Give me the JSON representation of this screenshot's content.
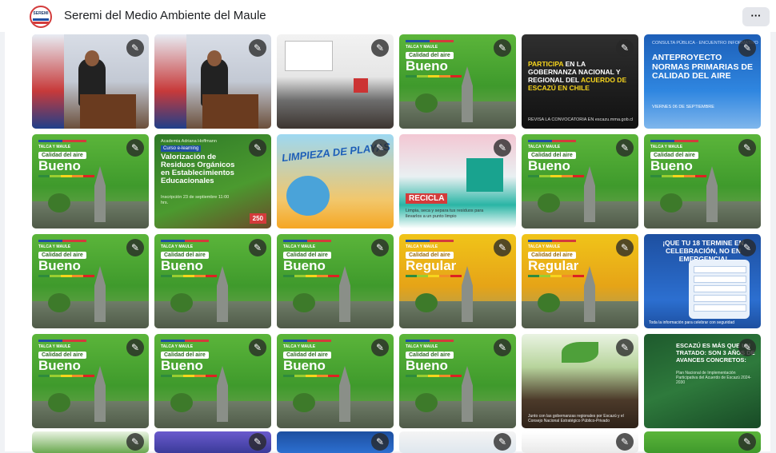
{
  "header": {
    "page_name": "Seremi del Medio Ambiente del Maule",
    "logo_text": "SEREMI",
    "more_label": "···"
  },
  "edit_icon": "pencil-icon",
  "colors": {
    "page_bg": "#f0f2f5",
    "air_good": "#4aa834",
    "air_regular": "#f0b419",
    "brand_blue": "#1f4fa3",
    "brand_red": "#d33b3b"
  },
  "air_quality": {
    "region": "TALCA Y MAULE",
    "label": "Calidad del aire",
    "good": "Bueno",
    "regular": "Regular"
  },
  "posts": {
    "escazu_participa": {
      "title_1": "PARTICIPA",
      "title_2": " EN LA GOBERNANZA NACIONAL Y REGIONAL DEL ",
      "title_3": "ACUERDO DE ESCAZÚ EN CHILE",
      "footer": "REVISA LA CONVOCATORIA EN escazu.mma.gob.cl"
    },
    "anteproyecto": {
      "pre": "CONSULTA PÚBLICA · ENCUENTRO INFORMATIVO",
      "title": "ANTEPROYECTO NORMAS PRIMARIAS DE CALIDAD DEL AIRE",
      "date": "VIERNES 06 DE SEPTIEMBRE"
    },
    "course": {
      "pre": "Academia Adriana Hoffmann",
      "tag": "Curso e-learning",
      "title": "Valorización de Residuos Orgánicos en Establecimientos Educacionales",
      "sub": "Inscripción 23 de septiembre 11:00 hrs.",
      "badge": "250"
    },
    "beach": {
      "title": "LIMPIEZA DE PLAYAS"
    },
    "recycle": {
      "word": "RECICLA",
      "sub": "Limpia, seca y separa tus residuos para llevarlos a un punto limpio"
    },
    "fiestas": {
      "title": "¡QUE TU 18 TERMINE EN CELEBRACIÓN, NO EN EMERGENCIA!",
      "footer": "Toda la información para celebrar con seguridad"
    },
    "seed": {
      "text": "Junto con las gobernanzas regionales por Escazú y el Consejo Nacional Estratégico Público-Privado"
    },
    "escazu_avances": {
      "title": "ESCAZÚ ES MÁS QUE UN TRATADO: SON 3 AÑOS DE AVANCES CONCRETOS:",
      "sub": "Plan Nacional de Implementación Participativa del Acuerdo de Escazú 2024-2030"
    }
  }
}
